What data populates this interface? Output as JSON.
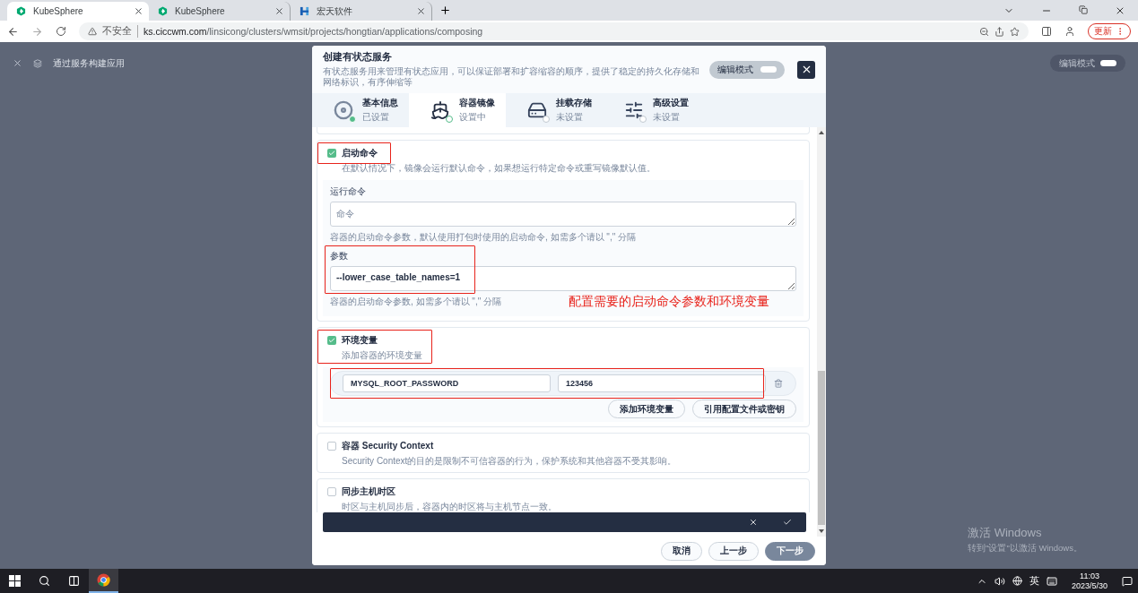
{
  "browser": {
    "tabs": [
      {
        "title": "KubeSphere",
        "kind": "kubesphere",
        "selected": true
      },
      {
        "title": "KubeSphere",
        "kind": "kubesphere",
        "selected": false
      },
      {
        "title": "宏天软件",
        "kind": "letter",
        "selected": false
      }
    ],
    "security": "不安全",
    "url_host": "ks.ciccwm.com",
    "url_path": "/linsicong/clusters/wmsit/projects/hongtian/applications/composing",
    "update": "更新"
  },
  "page": {
    "title": "通过服务构建应用",
    "edit_mode": "编辑模式"
  },
  "modal": {
    "title": "创建有状态服务",
    "description": "有状态服务用来管理有状态应用，可以保证部署和扩容缩容的顺序，提供了稳定的持久化存储和网络标识，有序伸缩等",
    "edit_mode": {
      "label": "编辑模式",
      "on": false
    },
    "steps": [
      {
        "title": "基本信息",
        "status": "已设置",
        "kind": "disc",
        "completed": true,
        "selected": false
      },
      {
        "title": "容器镜像",
        "status": "设置中",
        "kind": "ship",
        "completed": false,
        "selected": true
      },
      {
        "title": "挂载存储",
        "status": "未设置",
        "kind": "drive",
        "completed": false,
        "selected": false
      },
      {
        "title": "高级设置",
        "status": "未设置",
        "kind": "sliders",
        "completed": false,
        "selected": false
      }
    ],
    "command": {
      "title": "启动命令",
      "checked": true,
      "description": "在默认情况下，镜像会运行默认命令，如果想运行特定命令或重写镜像默认值。",
      "run_label": "运行命令",
      "run_placeholder": "命令",
      "run_hint": "容器的启动命令参数，默认使用打包时使用的启动命令, 如需多个请以 \",\" 分隔",
      "args_label": "参数",
      "args_value": "--lower_case_table_names=1",
      "args_hint": "容器的启动命令参数, 如需多个请以 \",\" 分隔"
    },
    "env": {
      "title": "环境变量",
      "checked": true,
      "description": "添加容器的环境变量",
      "rows": [
        {
          "name": "MYSQL_ROOT_PASSWORD",
          "value": "123456"
        }
      ],
      "buttons": [
        "添加环境变量",
        "引用配置文件或密钥"
      ]
    },
    "security": {
      "title": "容器 Security Context",
      "checked": false,
      "description": "Security Context的目的是限制不可信容器的行为，保护系统和其他容器不受其影响。"
    },
    "timezone": {
      "title": "同步主机时区",
      "checked": false,
      "description": "时区与主机同步后，容器内的时区将与主机节点一致。"
    },
    "footer": [
      {
        "label": "取消",
        "kind": "default"
      },
      {
        "label": "上一步",
        "kind": "default"
      },
      {
        "label": "下一步",
        "kind": "primary"
      }
    ]
  },
  "annotation": "配置需要的启动命令参数和环境变量",
  "activation": {
    "title": "激活 Windows",
    "hint": "转到\"设置\"以激活 Windows。"
  },
  "taskbar": {
    "language": "英",
    "time": "11:03",
    "date": "2023/5/30"
  }
}
